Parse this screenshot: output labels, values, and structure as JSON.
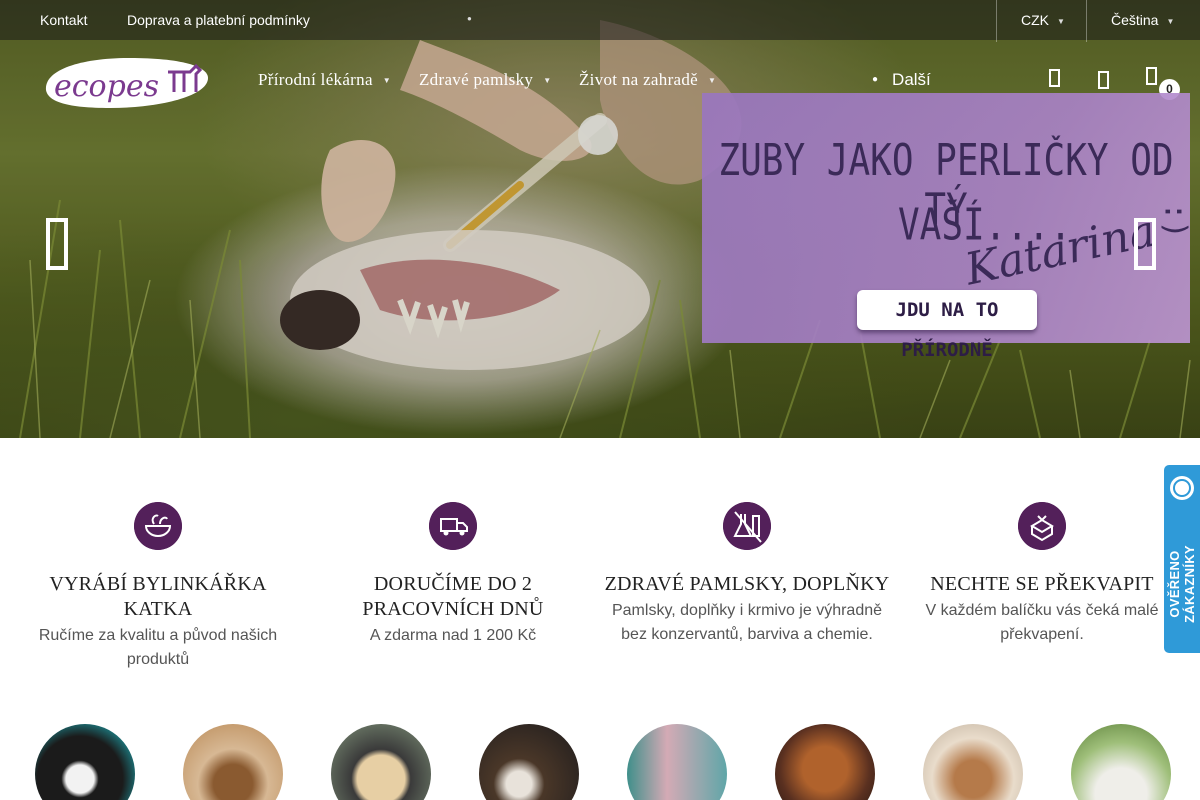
{
  "topbar": {
    "links": [
      "Kontakt",
      "Doprava a platební podmínky"
    ],
    "currency": "CZK",
    "language": "Čeština"
  },
  "logo": {
    "text": "ecopes"
  },
  "nav": {
    "items": [
      "Přírodní lékárna",
      "Zdravé pamlsky",
      "Život na zahradě"
    ],
    "more": "Další"
  },
  "cart": {
    "count": "0"
  },
  "hero": {
    "promo": {
      "line1": "ZUBY JAKO PERLIČKY OD TÝ",
      "line2": "VAŠÍ....",
      "signature": "Katarina",
      "smiley": ":)",
      "cta": "JDU NA TO PŘÍRODNĚ"
    }
  },
  "features": [
    {
      "icon": "herb-bowl-icon",
      "title": "VYRÁBÍ BYLINKÁŘKA KATKA",
      "text": "Ručíme za kvalitu a původ našich produktů"
    },
    {
      "icon": "delivery-truck-icon",
      "title": "DORUČÍME DO 2 PRACOVNÍCH DNŮ",
      "text": "A zdarma nad 1 200 Kč"
    },
    {
      "icon": "no-chemicals-icon",
      "title": "ZDRAVÉ PAMLSKY, DOPLŇKY",
      "text": "Pamlsky, doplňky i krmivo je výhradně bez konzervantů, barviva a chemie."
    },
    {
      "icon": "gift-box-icon",
      "title": "NECHTE SE PŘEKVAPIT",
      "text": "V každém balíčku vás čeká malé překvapení."
    }
  ],
  "badge": {
    "text": "OVĚŘENO ZÁKAZNÍKY"
  },
  "colors": {
    "accent": "#53205a",
    "promo": "#a37fc6",
    "badge": "#2f9ad8"
  }
}
